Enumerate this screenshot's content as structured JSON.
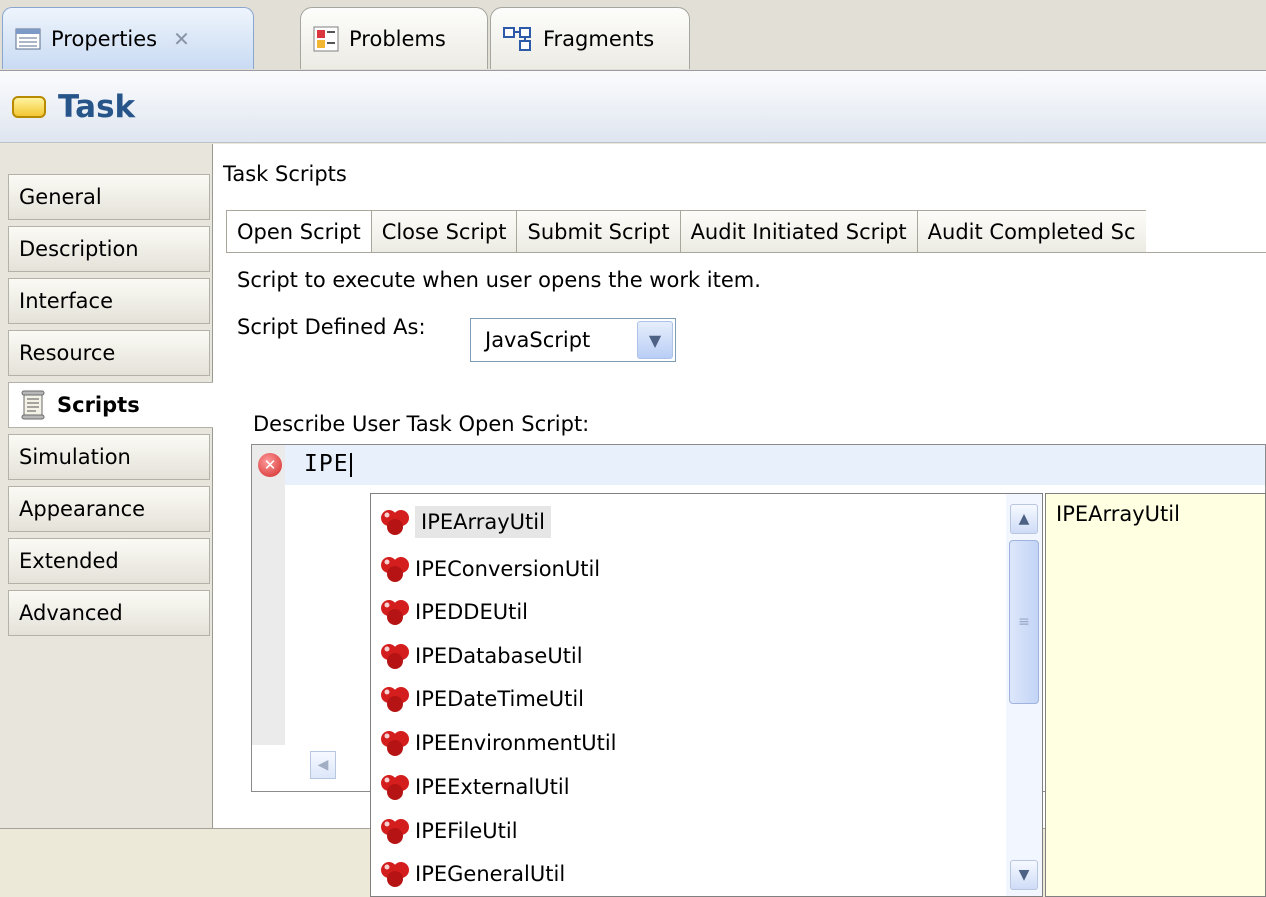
{
  "view_tabs": [
    {
      "label": "Properties",
      "icon": "properties-table-icon"
    },
    {
      "label": "Problems",
      "icon": "problems-icon"
    },
    {
      "label": "Fragments",
      "icon": "fragments-icon"
    }
  ],
  "header": {
    "title": "Task",
    "icon": "task-icon"
  },
  "sections": [
    {
      "label": "General"
    },
    {
      "label": "Description"
    },
    {
      "label": "Interface"
    },
    {
      "label": "Resource"
    },
    {
      "label": "Scripts",
      "selected": true,
      "icon": "scroll-icon"
    },
    {
      "label": "Simulation"
    },
    {
      "label": "Appearance"
    },
    {
      "label": "Extended"
    },
    {
      "label": "Advanced"
    }
  ],
  "task_scripts": {
    "title": "Task Scripts",
    "tabs": [
      {
        "label": "Open Script"
      },
      {
        "label": "Close Script"
      },
      {
        "label": "Submit Script"
      },
      {
        "label": "Audit Initiated Script"
      },
      {
        "label": "Audit Completed Sc"
      }
    ],
    "description": "Script to execute when user opens the work item.",
    "defined_as_label": "Script Defined As:",
    "defined_as_value": "JavaScript",
    "editor_label": "Describe User Task Open Script:",
    "editor_text": "IPE"
  },
  "assist": {
    "items": [
      "IPEArrayUtil",
      "IPEConversionUtil",
      "IPEDDEUtil",
      "IPEDatabaseUtil",
      "IPEDateTimeUtil",
      "IPEEnvironmentUtil",
      "IPEExternalUtil",
      "IPEFileUtil",
      "IPEGeneralUtil"
    ],
    "selected_index": 0,
    "info": "IPEArrayUtil"
  },
  "colors": {
    "header_title": "#27558a",
    "info_background": "#ffffe1",
    "active_line": "#e8f0fb"
  }
}
